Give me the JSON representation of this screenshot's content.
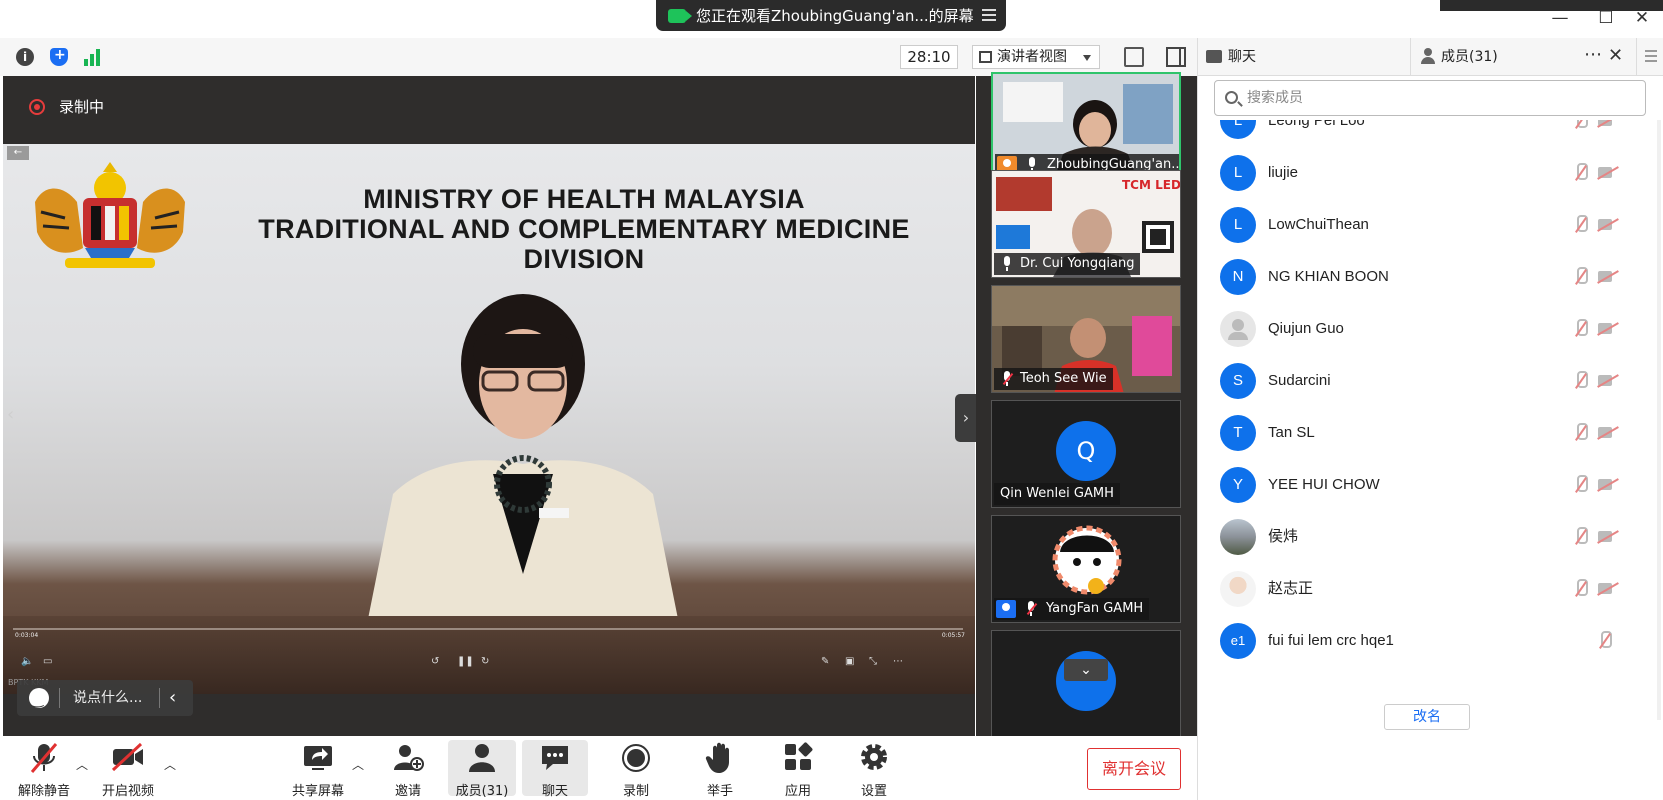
{
  "window": {
    "share_banner": "您正在观看ZhoubingGuang'an...的屏幕",
    "controls": {
      "minimize": "—",
      "maximize": "☐",
      "close": "✕"
    }
  },
  "toolbar": {
    "timer": "28:10",
    "view_mode": "演讲者视图"
  },
  "stage": {
    "recording_label": "录制中",
    "slide_title_line1": "MINISTRY OF HEALTH MALAYSIA",
    "slide_title_line2": "TRADITIONAL AND COMPLEMENTARY MEDICINE DIVISION",
    "video_time_elapsed": "0:03:04",
    "video_time_total": "0:05:57",
    "watermark": "BPTK KKM",
    "chat_placeholder": "说点什么..."
  },
  "thumbnails": [
    {
      "name": "ZhoubingGuang'an...",
      "host": true,
      "host_color": "#f08a2b",
      "muted": false
    },
    {
      "name": "Dr. Cui Yongqiang",
      "host": false,
      "muted": false
    },
    {
      "name": "Teoh See Wie",
      "host": false,
      "muted": true
    },
    {
      "name": "Qin Wenlei GAMH",
      "initial": "Q",
      "host": false,
      "muted": false
    },
    {
      "name": "YangFan GAMH",
      "host": true,
      "host_color": "#1b6ef3",
      "muted": true
    }
  ],
  "thumb_scroll_icon": "chevron-down",
  "bottom_bar": {
    "unmute": "解除静音",
    "start_video": "开启视频",
    "share_screen": "共享屏幕",
    "invite": "邀请",
    "participants": "成员(31)",
    "chat": "聊天",
    "record": "录制",
    "raise_hand": "举手",
    "apps": "应用",
    "settings": "设置",
    "leave": "离开会议"
  },
  "panel": {
    "tab_chat": "聊天",
    "tab_members": "成员(31)",
    "search_placeholder": "搜索成员",
    "rename": "改名",
    "members": [
      {
        "initial": "L",
        "name": "Leong Pei Loo",
        "avatar": "letter",
        "video_off": true
      },
      {
        "initial": "L",
        "name": "liujie",
        "avatar": "letter",
        "video_off": true
      },
      {
        "initial": "L",
        "name": "LowChuiThean",
        "avatar": "letter",
        "video_off": true
      },
      {
        "initial": "N",
        "name": "NG KHIAN BOON",
        "avatar": "letter",
        "video_off": true
      },
      {
        "initial": "",
        "name": "Qiujun Guo",
        "avatar": "grey",
        "video_off": true
      },
      {
        "initial": "S",
        "name": "Sudarcini",
        "avatar": "letter",
        "video_off": true
      },
      {
        "initial": "T",
        "name": "Tan SL",
        "avatar": "letter",
        "video_off": true
      },
      {
        "initial": "Y",
        "name": "YEE HUI CHOW",
        "avatar": "letter",
        "video_off": true
      },
      {
        "initial": "",
        "name": "侯炜",
        "avatar": "photo1",
        "video_off": true
      },
      {
        "initial": "",
        "name": "赵志正",
        "avatar": "photo2",
        "video_off": true
      },
      {
        "initial": "e1",
        "name": "fui fui lem crc hqe1",
        "avatar": "letter",
        "video_off": false
      }
    ]
  },
  "colors": {
    "accent_blue": "#0e71eb",
    "active_green": "#2fc46b",
    "danger_red": "#e03131"
  }
}
